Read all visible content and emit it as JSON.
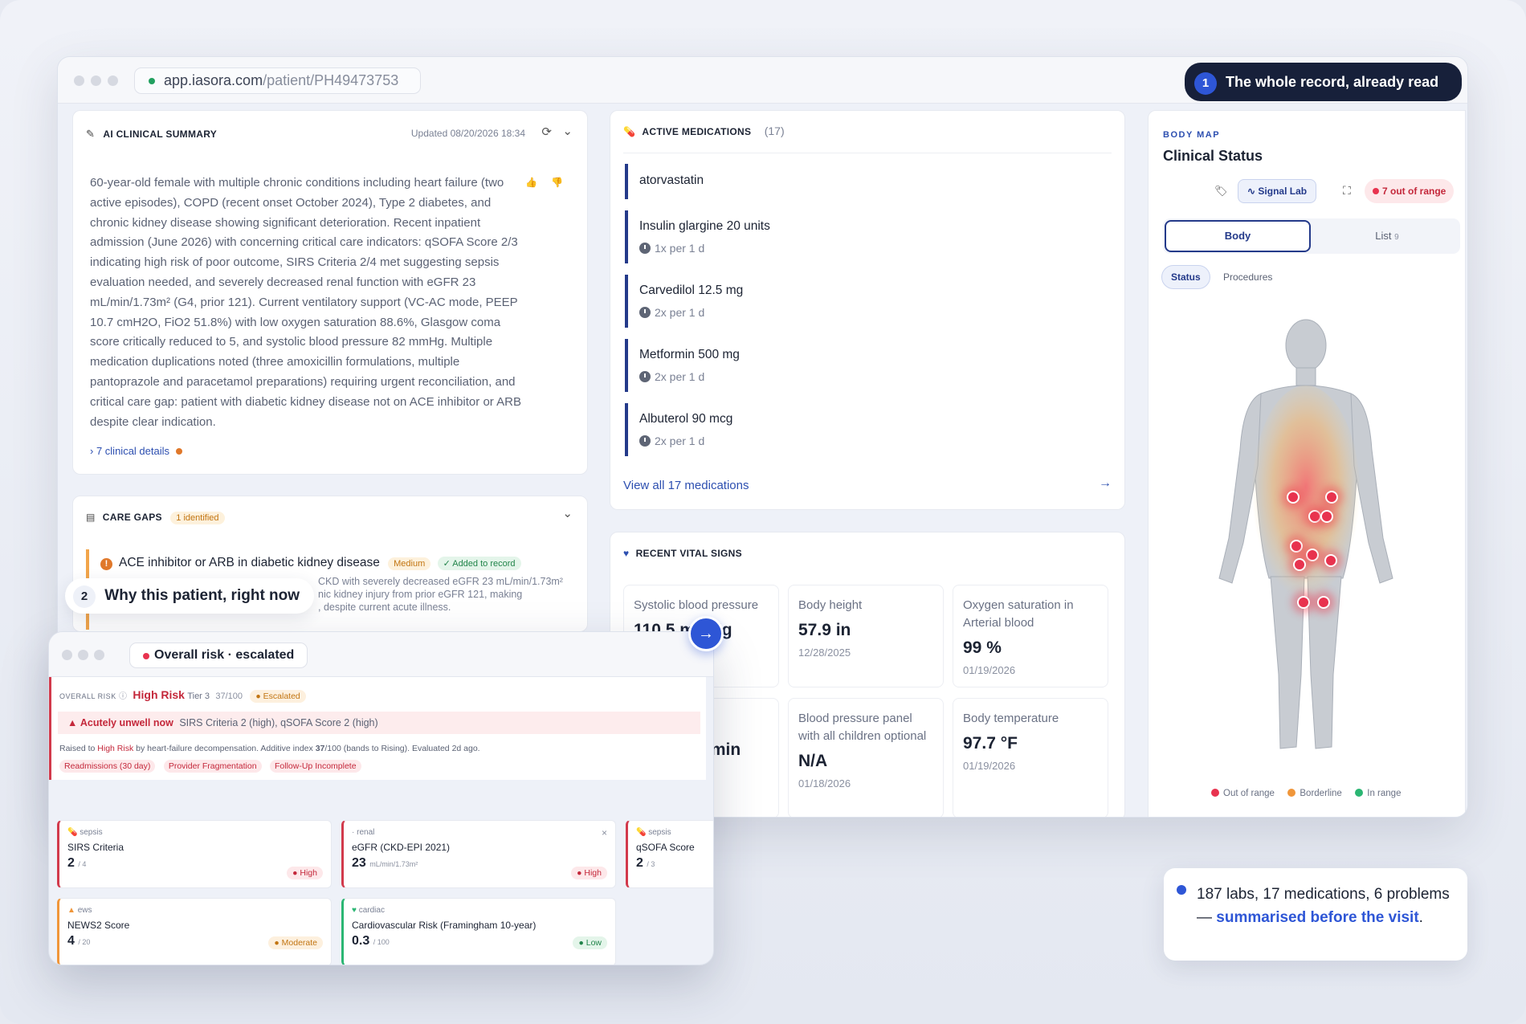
{
  "browser": {
    "url_domain": "app.iasora.com",
    "url_path": "/patient/PH49473753"
  },
  "callout1": {
    "num": "1",
    "text": "The whole record, already read"
  },
  "callout2": {
    "num": "2",
    "text": "Why this patient, right now"
  },
  "summary": {
    "title": "AI CLINICAL SUMMARY",
    "updated": "Updated 08/20/2026 18:34",
    "text": "60-year-old female with multiple chronic conditions including heart failure (two active episodes), COPD (recent onset October 2024), Type 2 diabetes, and chronic kidney disease showing significant deterioration. Recent inpatient admission (June 2026) with concerning critical care indicators: qSOFA Score 2/3 indicating high risk of poor outcome, SIRS Criteria 2/4 met suggesting sepsis evaluation needed, and severely decreased renal function with eGFR 23 mL/min/1.73m² (G4, prior 121). Current ventilatory support (VC-AC mode, PEEP 10.7 cmH2O, FiO2 51.8%) with low oxygen saturation 88.6%, Glasgow coma score critically reduced to 5, and systolic blood pressure 82 mmHg. Multiple medication duplications noted (three amoxicillin formulations, multiple pantoprazole and paracetamol preparations) requiring urgent reconciliation, and critical care gap: patient with diabetic kidney disease not on ACE inhibitor or ARB despite clear indication.",
    "details": "7 clinical details"
  },
  "care_gaps": {
    "title": "CARE GAPS",
    "count": "1 identified",
    "item": "ACE inhibitor or ARB in diabetic kidney disease",
    "severity": "Medium",
    "status": "✓ Added to record",
    "desc1": "CKD with severely decreased eGFR 23 mL/min/1.73m²",
    "desc2": "nic kidney injury from prior eGFR 121, making",
    "desc3": ", despite current acute illness."
  },
  "meds": {
    "title": "ACTIVE MEDICATIONS",
    "count": "(17)",
    "items": [
      {
        "name": "atorvastatin",
        "freq": ""
      },
      {
        "name": "Insulin glargine 20 units",
        "freq": "1x per 1 d"
      },
      {
        "name": "Carvedilol 12.5 mg",
        "freq": "2x per 1 d"
      },
      {
        "name": "Metformin 500 mg",
        "freq": "2x per 1 d"
      },
      {
        "name": "Albuterol 90 mcg",
        "freq": "2x per 1 d"
      }
    ],
    "view_all": "View all 17 medications"
  },
  "vitals": {
    "title": "RECENT VITAL SIGNS",
    "items": [
      {
        "label": "Systolic blood pressure",
        "value": "110.5 mmHg",
        "date": ""
      },
      {
        "label": "Body height",
        "value": "57.9 in",
        "date": "12/28/2025"
      },
      {
        "label": "Oxygen saturation in Arterial blood",
        "value": "99 %",
        "date": "01/19/2026"
      },
      {
        "label": "",
        "value": "/min",
        "date": ""
      },
      {
        "label": "Blood pressure panel with all children optional",
        "value": "N/A",
        "date": "01/18/2026"
      },
      {
        "label": "Body temperature",
        "value": "97.7 °F",
        "date": "01/19/2026"
      }
    ]
  },
  "body_map": {
    "eyebrow": "BODY MAP",
    "title": "Clinical Status",
    "signal_lab": "Signal Lab",
    "out_of_range": "7 out of range",
    "tab_body": "Body",
    "tab_list": "List",
    "list_count": "9",
    "chip_status": "Status",
    "chip_procedures": "Procedures",
    "legend": [
      "Out of range",
      "Borderline",
      "In range"
    ],
    "colors": {
      "out": "#e8334f",
      "border": "#f0963a",
      "in": "#2bb673"
    }
  },
  "overlay": {
    "title": "Overall risk · escalated",
    "overall_label": "OVERALL RISK",
    "risk": "High Risk",
    "tier": "Tier 3",
    "score": "37/100",
    "escalated": "Escalated",
    "alert_title": "Acutely unwell now",
    "alert_text": "SIRS Criteria 2 (high), qSOFA Score 2 (high)",
    "raised_a": "Raised to",
    "raised_b": "High Risk",
    "raised_c": "by heart-failure decompensation. Additive index",
    "raised_d": "37",
    "raised_e": "/100 (bands to Rising). Evaluated 2d ago.",
    "tags": [
      "Readmissions (30 day)",
      "Provider Fragmentation",
      "Follow-Up Incomplete"
    ],
    "cards": [
      {
        "cat": "sepsis",
        "title": "SIRS Criteria",
        "score": "2",
        "of": "/ 4",
        "badge": "High"
      },
      {
        "cat": "renal",
        "title": "eGFR (CKD-EPI 2021)",
        "score": "23",
        "of": "mL/min/1.73m²",
        "badge": "High"
      },
      {
        "cat": "sepsis",
        "title": "qSOFA Score",
        "score": "2",
        "of": "/ 3",
        "badge": ""
      },
      {
        "cat": "ews",
        "title": "NEWS2 Score",
        "score": "4",
        "of": "/ 20",
        "badge": "Moderate"
      },
      {
        "cat": "cardiac",
        "title": "Cardiovascular Risk (Framingham 10-year)",
        "score": "0.3",
        "of": "/ 100",
        "badge": "Low"
      }
    ]
  },
  "note": {
    "text_a": "187 labs, 17 medications, 6 problems —",
    "text_b": "summarised before the visit",
    "text_c": "."
  }
}
